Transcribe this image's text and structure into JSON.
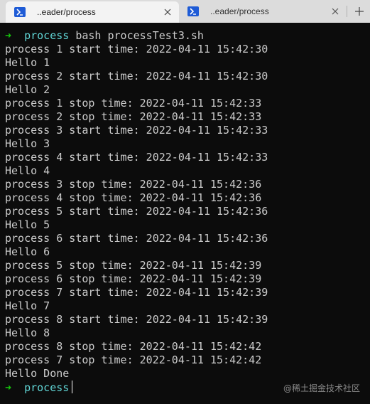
{
  "tabs": [
    {
      "title": "..eader/process",
      "active": true
    },
    {
      "title": "..eader/process",
      "active": false
    }
  ],
  "icons": {
    "tab_icon": "powershell-icon",
    "close": "close-icon",
    "new_tab": "plus-icon"
  },
  "terminal": {
    "command_line": {
      "arrow": "➜",
      "directory": "process",
      "command": "bash processTest3.sh"
    },
    "output": [
      "process 1 start time: 2022-04-11 15:42:30",
      "Hello 1",
      "process 2 start time: 2022-04-11 15:42:30",
      "Hello 2",
      "process 1 stop time: 2022-04-11 15:42:33",
      "process 2 stop time: 2022-04-11 15:42:33",
      "process 3 start time: 2022-04-11 15:42:33",
      "Hello 3",
      "process 4 start time: 2022-04-11 15:42:33",
      "Hello 4",
      "process 3 stop time: 2022-04-11 15:42:36",
      "process 4 stop time: 2022-04-11 15:42:36",
      "process 5 start time: 2022-04-11 15:42:36",
      "Hello 5",
      "process 6 start time: 2022-04-11 15:42:36",
      "Hello 6",
      "process 5 stop time: 2022-04-11 15:42:39",
      "process 6 stop time: 2022-04-11 15:42:39",
      "process 7 start time: 2022-04-11 15:42:39",
      "Hello 7",
      "process 8 start time: 2022-04-11 15:42:39",
      "Hello 8",
      "process 8 stop time: 2022-04-11 15:42:42",
      "process 7 stop time: 2022-04-11 15:42:42",
      "Hello Done"
    ],
    "final_prompt": {
      "arrow": "➜",
      "directory": "process"
    }
  },
  "watermark": "@稀土掘金技术社区",
  "colors": {
    "background": "#0c0c0c",
    "text": "#cccccc",
    "prompt_arrow": "#16c60c",
    "prompt_dir": "#61d6d6",
    "tab_icon": "#1e5bd6"
  }
}
